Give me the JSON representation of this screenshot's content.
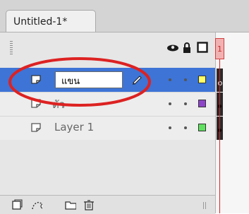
{
  "tab": {
    "title": "Untitled-1*"
  },
  "timeline": {
    "frame_number": "1"
  },
  "layers": [
    {
      "name": "แขน",
      "editing": true,
      "selected": true,
      "outline_color": "#ffff66",
      "keyframe": "empty"
    },
    {
      "name": "ตัว",
      "editing": false,
      "selected": false,
      "outline_color": "#8e44c8",
      "keyframe": "filled"
    },
    {
      "name": "Layer 1",
      "editing": false,
      "selected": false,
      "outline_color": "#5fe05f",
      "keyframe": "filled"
    }
  ],
  "icons": {
    "header": [
      "eye-icon",
      "lock-icon",
      "outline-icon"
    ],
    "layer": "layer-icon",
    "edit": "pencil-icon",
    "bottom": [
      "new-layer-icon",
      "add-motion-guide-icon",
      "new-folder-icon",
      "delete-icon"
    ]
  },
  "colors": {
    "selection": "#3d74d6",
    "playhead": "#e02020",
    "annotation": "#dd2222"
  }
}
